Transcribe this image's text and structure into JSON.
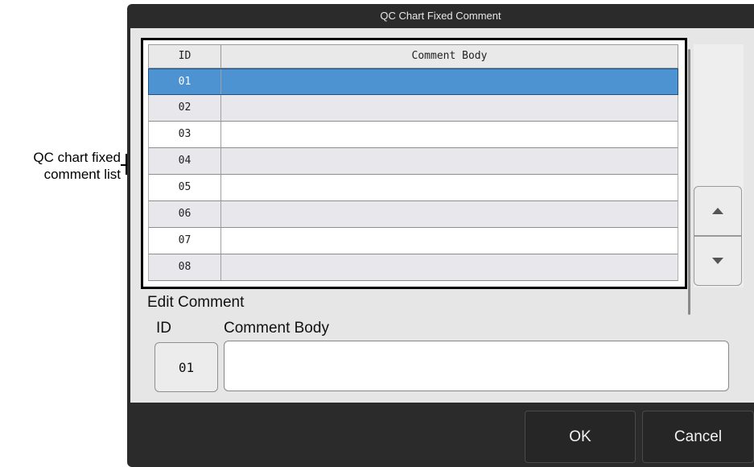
{
  "annotation": {
    "label_line1": "QC chart fixed",
    "label_line2": "comment list"
  },
  "dialog": {
    "title": "QC Chart Fixed Comment"
  },
  "table": {
    "headers": {
      "id": "ID",
      "body": "Comment Body"
    },
    "rows": [
      {
        "id": "01",
        "body": "",
        "selected": true
      },
      {
        "id": "02",
        "body": ""
      },
      {
        "id": "03",
        "body": ""
      },
      {
        "id": "04",
        "body": ""
      },
      {
        "id": "05",
        "body": ""
      },
      {
        "id": "06",
        "body": ""
      },
      {
        "id": "07",
        "body": ""
      },
      {
        "id": "08",
        "body": ""
      }
    ]
  },
  "edit": {
    "title": "Edit Comment",
    "id_label": "ID",
    "body_label": "Comment Body",
    "id_value": "01",
    "body_value": ""
  },
  "buttons": {
    "ok": "OK",
    "cancel": "Cancel",
    "scroll_up_icon": "triangle-up-icon",
    "scroll_down_icon": "triangle-down-icon"
  },
  "colors": {
    "selected_row": "#4d92d1",
    "dialog_bg": "#2b2b2b",
    "panel_bg": "#e6e6e6"
  }
}
